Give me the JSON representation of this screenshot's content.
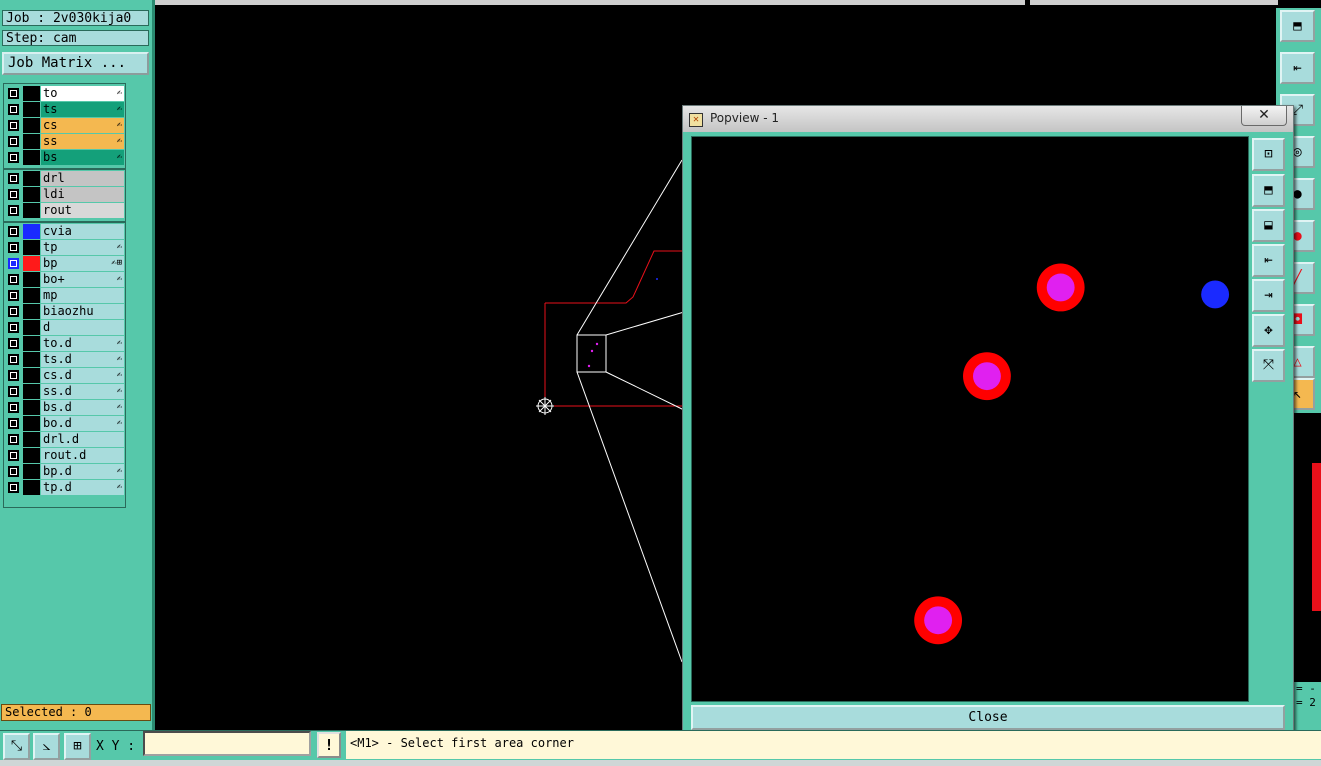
{
  "info": {
    "job": "Job : 2v030kija0",
    "step": "Step: cam",
    "job_matrix": "Job Matrix ...",
    "selected": "Selected : 0"
  },
  "layers": [
    {
      "name": "to",
      "color": "#ffffff",
      "mark": "✍",
      "swatch": ""
    },
    {
      "name": "ts",
      "color": "#14a07a",
      "mark": "✍",
      "swatch": ""
    },
    {
      "name": "cs",
      "color": "#f4b850",
      "mark": "✍",
      "swatch": ""
    },
    {
      "name": "ss",
      "color": "#f4b850",
      "mark": "✍",
      "swatch": ""
    },
    {
      "name": "bs",
      "color": "#14a07a",
      "mark": "✍",
      "swatch": ""
    },
    {
      "name": "drl",
      "color": "#c4c4c4",
      "mark": "",
      "swatch": ""
    },
    {
      "name": "ldi",
      "color": "#c4c4c4",
      "mark": "",
      "swatch": ""
    },
    {
      "name": "rout",
      "color": "#d8d8d8",
      "mark": "",
      "swatch": ""
    },
    {
      "name": "cvia",
      "color": "#a8dcdc",
      "mark": "",
      "swatch": "#1a2aff"
    },
    {
      "name": "tp",
      "color": "#a8dcdc",
      "mark": "✍",
      "swatch": ""
    },
    {
      "name": "bp",
      "color": "#a8dcdc",
      "mark": "✍⊞",
      "swatch": "#ff1a1a",
      "active": true
    },
    {
      "name": "bo+",
      "color": "#a8dcdc",
      "mark": "✍",
      "swatch": ""
    },
    {
      "name": "mp",
      "color": "#a8dcdc",
      "mark": "",
      "swatch": ""
    },
    {
      "name": "biaozhu",
      "color": "#a8dcdc",
      "mark": "",
      "swatch": ""
    },
    {
      "name": "d",
      "color": "#a8dcdc",
      "mark": "",
      "swatch": ""
    },
    {
      "name": "to.d",
      "color": "#a8dcdc",
      "mark": "✍",
      "swatch": ""
    },
    {
      "name": "ts.d",
      "color": "#a8dcdc",
      "mark": "✍",
      "swatch": ""
    },
    {
      "name": "cs.d",
      "color": "#a8dcdc",
      "mark": "✍",
      "swatch": ""
    },
    {
      "name": "ss.d",
      "color": "#a8dcdc",
      "mark": "✍",
      "swatch": ""
    },
    {
      "name": "bs.d",
      "color": "#a8dcdc",
      "mark": "✍",
      "swatch": ""
    },
    {
      "name": "bo.d",
      "color": "#a8dcdc",
      "mark": "✍",
      "swatch": ""
    },
    {
      "name": "drl.d",
      "color": "#a8dcdc",
      "mark": "",
      "swatch": ""
    },
    {
      "name": "rout.d",
      "color": "#a8dcdc",
      "mark": "",
      "swatch": ""
    },
    {
      "name": "bp.d",
      "color": "#a8dcdc",
      "mark": "✍",
      "swatch": ""
    },
    {
      "name": "tp.d",
      "color": "#a8dcdc",
      "mark": "✍",
      "swatch": ""
    }
  ],
  "popview": {
    "title": "Popview - 1",
    "close_x": "✕",
    "close_button": "Close"
  },
  "bottom": {
    "xy_label": "X Y :",
    "xy_value": "",
    "excl": "!",
    "status": "<M1> - Select first area corner"
  },
  "right_panel": {
    "line1": "= -",
    "line2": "= 2"
  },
  "colors": {
    "panel": "#56c8aa",
    "button": "#a8dcdc",
    "outline_red": "#e8101a",
    "pad_outer": "#ff0000",
    "pad_inner": "#e020f0",
    "via_blue": "#1a2aff"
  }
}
